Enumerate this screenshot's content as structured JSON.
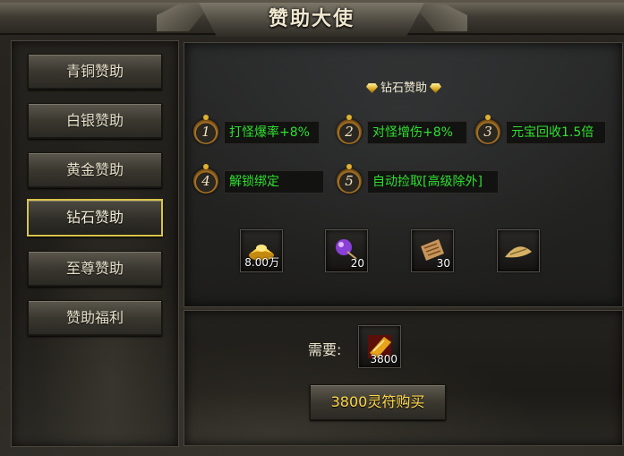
{
  "window": {
    "title": "赞助大使"
  },
  "tabs": [
    {
      "label": "青铜赞助",
      "active": false
    },
    {
      "label": "白银赞助",
      "active": false
    },
    {
      "label": "黄金赞助",
      "active": false
    },
    {
      "label": "钻石赞助",
      "active": true
    },
    {
      "label": "至尊赞助",
      "active": false
    },
    {
      "label": "赞助福利",
      "active": false
    }
  ],
  "tier": {
    "title": "钻石赞助"
  },
  "perks": [
    {
      "num": "1",
      "text": "打怪爆率+8%"
    },
    {
      "num": "2",
      "text": "对怪增伤+8%"
    },
    {
      "num": "3",
      "text": "元宝回收1.5倍"
    },
    {
      "num": "4",
      "text": "解锁绑定"
    },
    {
      "num": "5",
      "text": "自动捡取[高级除外]"
    }
  ],
  "rewards": [
    {
      "icon": "gold-ingot-icon",
      "count": "8.00万"
    },
    {
      "icon": "purple-orb-icon",
      "count": "20"
    },
    {
      "icon": "scroll-icon",
      "count": "30"
    },
    {
      "icon": "straw-hat-icon",
      "count": ""
    }
  ],
  "cost": {
    "label": "需要:",
    "icon": "spirit-talisman-icon",
    "amount": "3800"
  },
  "buy_button": {
    "label": "3800灵符购买"
  },
  "colors": {
    "perk_text": "#2fe02f",
    "button_text": "#ffd84a",
    "active_border": "#d9c44a"
  }
}
